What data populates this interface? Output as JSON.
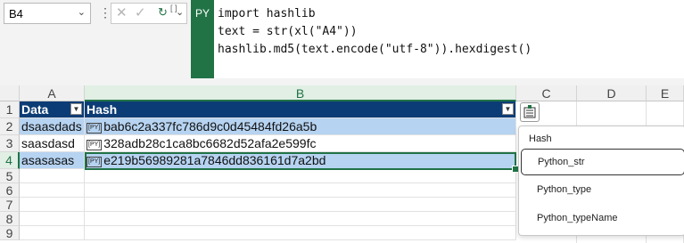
{
  "namebox": {
    "value": "B4"
  },
  "formula": {
    "badge": "PY",
    "lines": [
      "import hashlib",
      "text = str(xl(\"A4\"))",
      "hashlib.md5(text.encode(\"utf-8\")).hexdigest()"
    ]
  },
  "columns": [
    "A",
    "B",
    "C",
    "D",
    "E"
  ],
  "rows": [
    "1",
    "2",
    "3",
    "4",
    "5",
    "6",
    "7",
    "8",
    "9"
  ],
  "table": {
    "headers": [
      "Data",
      "Hash"
    ],
    "data": [
      {
        "data": "dsaasdads",
        "hash": "bab6c2a337fc786d9c0d45484fd26a5b"
      },
      {
        "data": "saasdasd",
        "hash": "328adb28c1ca8bc6682d52afa2e599fc"
      },
      {
        "data": "asasasas",
        "hash": "e219b56989281a7846dd836161d7a2bd"
      }
    ],
    "py_icon": "[PY]"
  },
  "autocomplete": {
    "title": "Hash",
    "items": [
      "Python_str",
      "Python_type",
      "Python_typeName"
    ]
  }
}
